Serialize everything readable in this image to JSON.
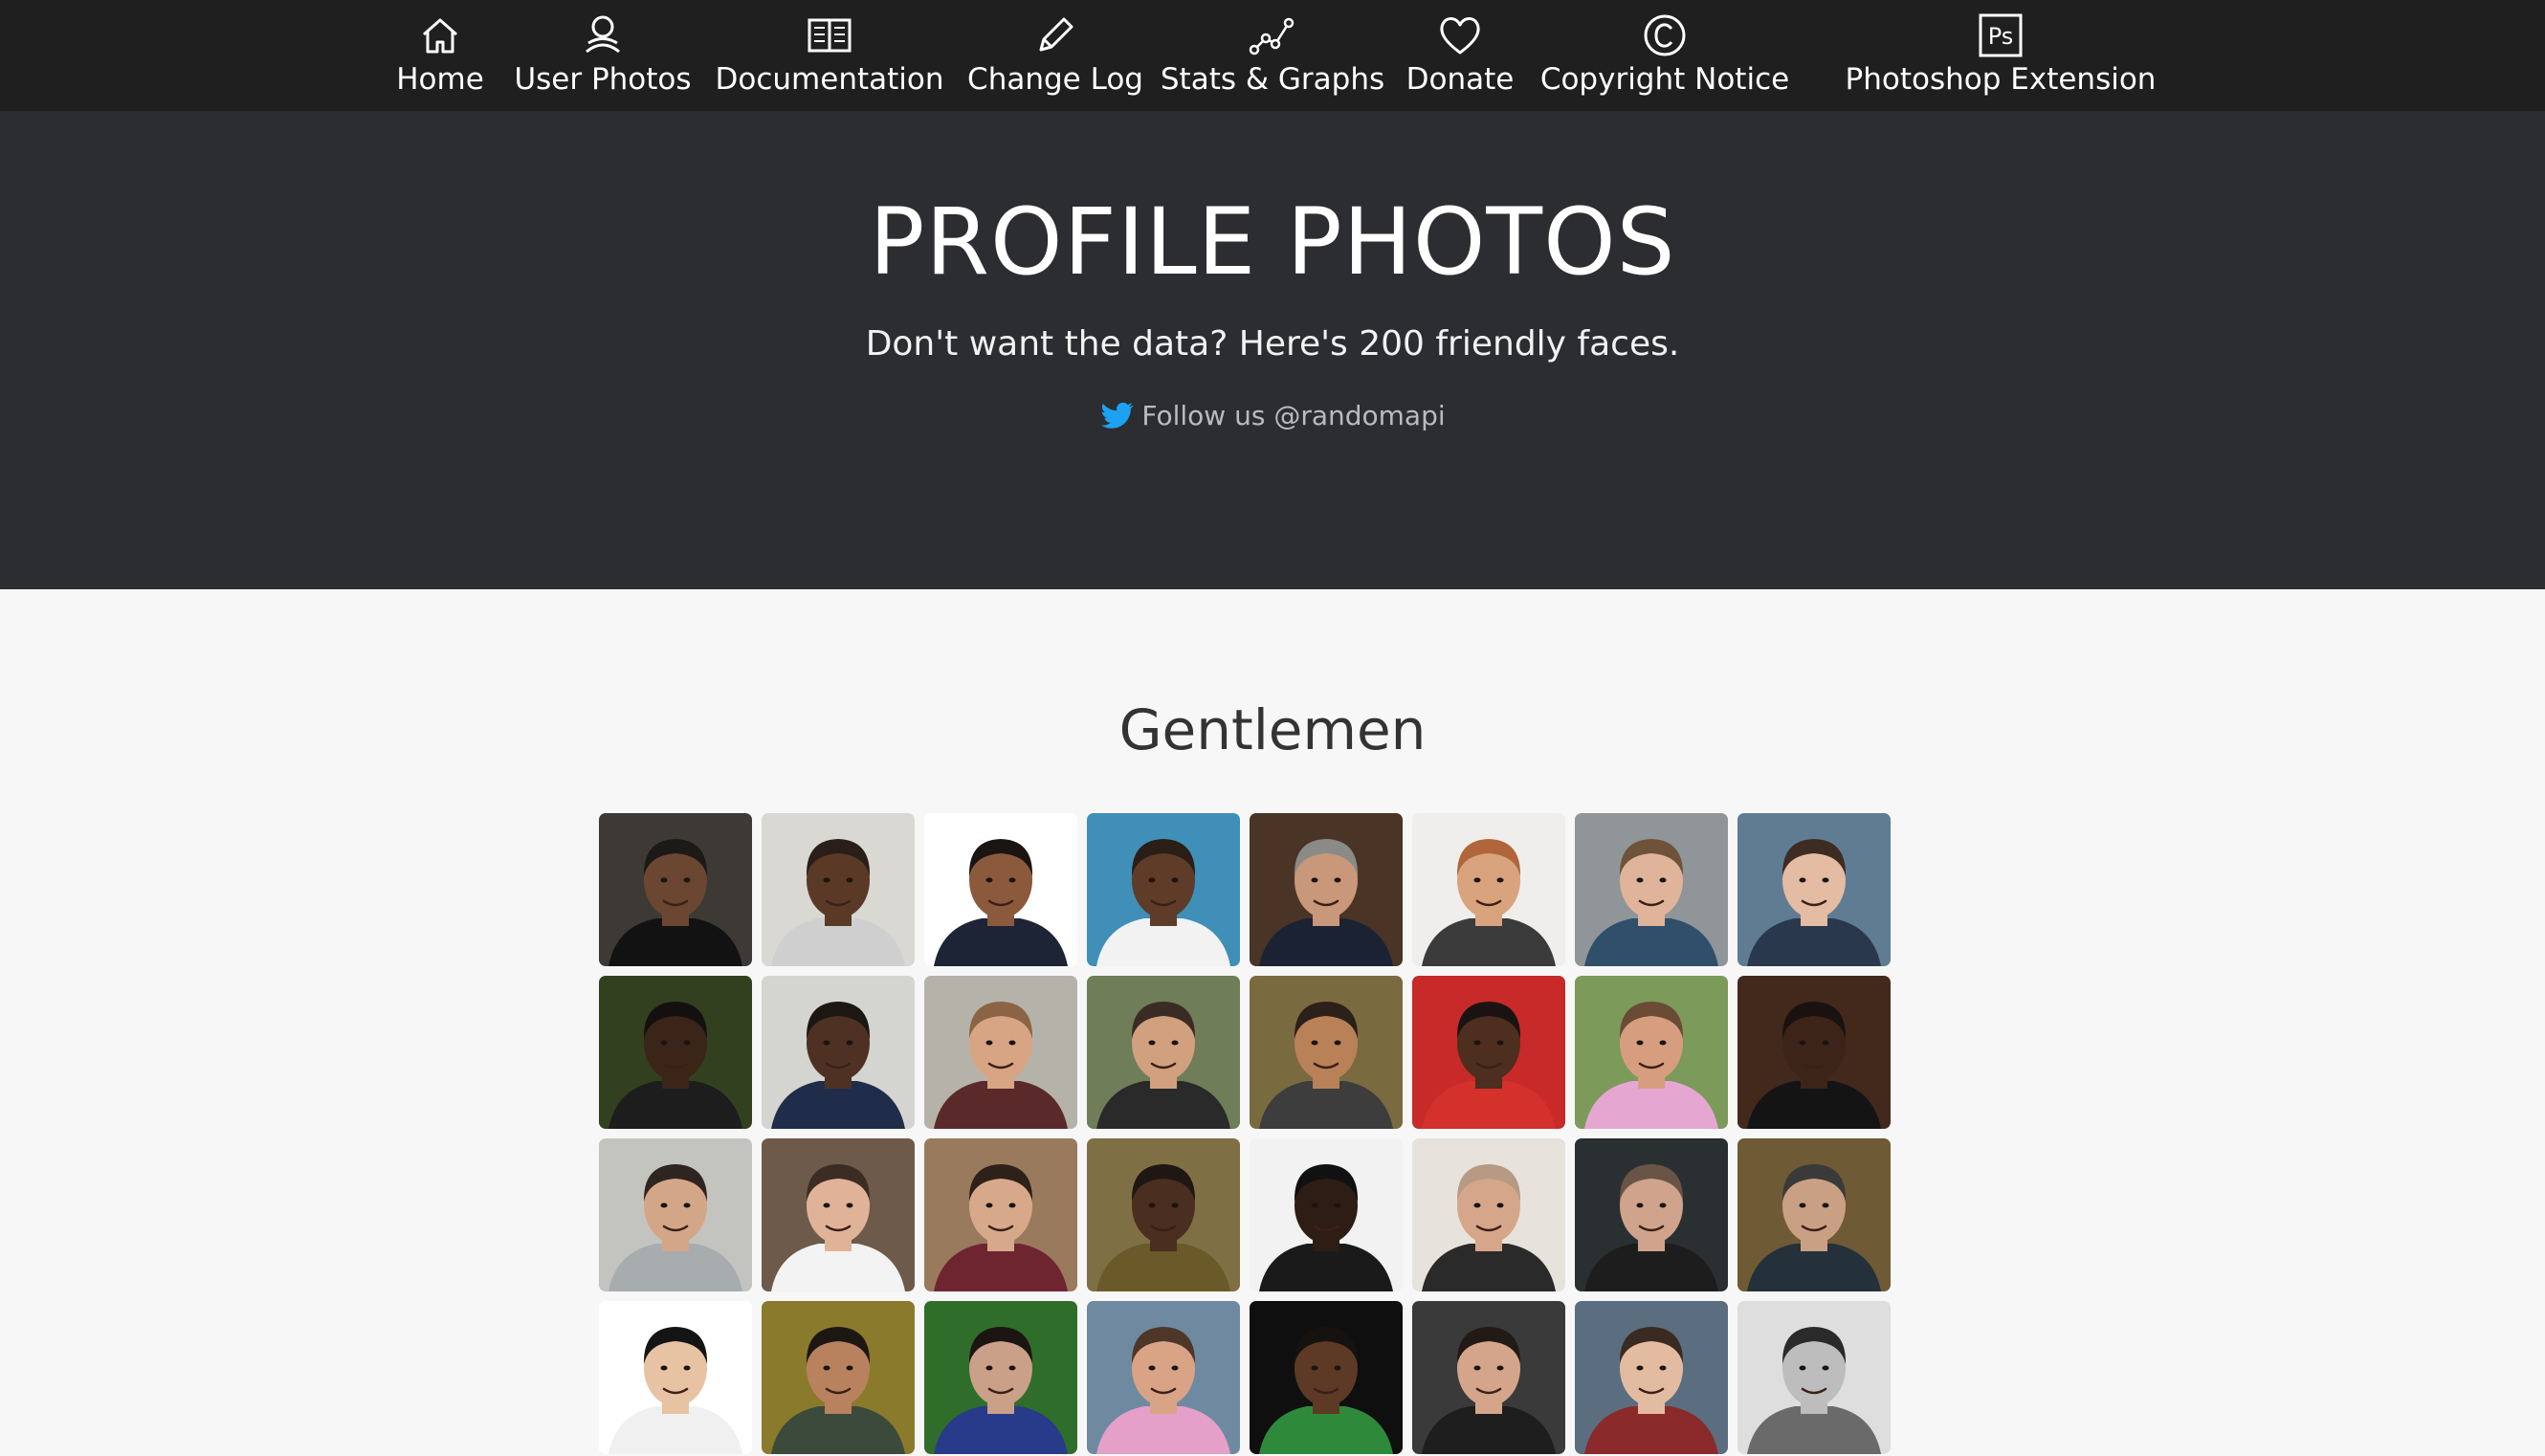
{
  "nav": {
    "items": [
      {
        "label": "Home",
        "icon": "home-icon"
      },
      {
        "label": "User Photos",
        "icon": "user-photos-icon"
      },
      {
        "label": "Documentation",
        "icon": "book-icon"
      },
      {
        "label": "Change Log",
        "icon": "pencil-icon"
      },
      {
        "label": "Stats & Graphs",
        "icon": "graph-icon"
      },
      {
        "label": "Donate",
        "icon": "heart-icon"
      },
      {
        "label": "Copyright Notice",
        "icon": "copyright-icon"
      },
      {
        "label": "Photoshop Extension",
        "icon": "photoshop-icon"
      }
    ]
  },
  "hero": {
    "title": "PROFILE PHOTOS",
    "subtitle": "Don't want the data? Here's 200 friendly faces.",
    "follow": "Follow us @randomapi",
    "follow_icon": "twitter-bird-icon",
    "twitter_color": "#1da1f2"
  },
  "section": {
    "title": "Gentlemen"
  },
  "photos": [
    {
      "bg": "#3d3a36",
      "skin": "#6b4630",
      "hair": "#1c1a18",
      "shirt": "#121212"
    },
    {
      "bg": "#d9d8d3",
      "skin": "#5a3a26",
      "hair": "#2a1f18",
      "shirt": "#cfcfcf"
    },
    {
      "bg": "#ffffff",
      "skin": "#8b5a3c",
      "hair": "#1a1512",
      "shirt": "#1c2436"
    },
    {
      "bg": "#3f8fb8",
      "skin": "#5e3c28",
      "hair": "#2a1e16",
      "shirt": "#f2f2f2"
    },
    {
      "bg": "#4a3426",
      "skin": "#c9977a",
      "hair": "#8a8a86",
      "shirt": "#1b2233"
    },
    {
      "bg": "#efeeec",
      "skin": "#d9a37e",
      "hair": "#b0663a",
      "shirt": "#3b3b3b"
    },
    {
      "bg": "#8f9599",
      "skin": "#e0b49a",
      "hair": "#6e5239",
      "shirt": "#2f4f6b"
    },
    {
      "bg": "#5f7c93",
      "skin": "#e4bba3",
      "hair": "#3d2c22",
      "shirt": "#29384d"
    },
    {
      "bg": "#33401f",
      "skin": "#3b2418",
      "hair": "#151010",
      "shirt": "#1d1d1d"
    },
    {
      "bg": "#d4d4d0",
      "skin": "#4e3122",
      "hair": "#1d1713",
      "shirt": "#1f2d4a"
    },
    {
      "bg": "#b5b2aa",
      "skin": "#d7a584",
      "hair": "#8a6444",
      "shirt": "#5a2a2a"
    },
    {
      "bg": "#6f7d58",
      "skin": "#d1a07e",
      "hair": "#3a2c24",
      "shirt": "#2a2a2a"
    },
    {
      "bg": "#7a6a40",
      "skin": "#b98158",
      "hair": "#2b201a",
      "shirt": "#3d3d3d"
    },
    {
      "bg": "#c72a28",
      "skin": "#4d2e1f",
      "hair": "#1a1311",
      "shirt": "#d4302c"
    },
    {
      "bg": "#7c9a5a",
      "skin": "#d69e7e",
      "hair": "#6a4b36",
      "shirt": "#e6a6d2"
    },
    {
      "bg": "#43281c",
      "skin": "#3d2418",
      "hair": "#1a1210",
      "shirt": "#141414"
    },
    {
      "bg": "#c3c3bf",
      "skin": "#d4a688",
      "hair": "#2f2520",
      "shirt": "#a7acae"
    },
    {
      "bg": "#6e5a4a",
      "skin": "#e0b398",
      "hair": "#3b2d24",
      "shirt": "#f3f3f3"
    },
    {
      "bg": "#9a7a5c",
      "skin": "#d7a98a",
      "hair": "#2d2119",
      "shirt": "#6e2530"
    },
    {
      "bg": "#7f6f44",
      "skin": "#4a2e1f",
      "hair": "#1f1713",
      "shirt": "#6a5a2a"
    },
    {
      "bg": "#f2f2f2",
      "skin": "#2e1d14",
      "hair": "#111111",
      "shirt": "#1a1a1a"
    },
    {
      "bg": "#e7e3dc",
      "skin": "#d6a68a",
      "hair": "#b69a84",
      "shirt": "#2a2a2a"
    },
    {
      "bg": "#2a3032",
      "skin": "#d0a48c",
      "hair": "#6a5446",
      "shirt": "#1d1d1d"
    },
    {
      "bg": "#6e5a34",
      "skin": "#caa084",
      "hair": "#3a3a3a",
      "shirt": "#24303a"
    },
    {
      "bg": "#ffffff",
      "skin": "#e7c3a3",
      "hair": "#141414",
      "shirt": "#f0f0f0"
    },
    {
      "bg": "#8a7a2c",
      "skin": "#b8825e",
      "hair": "#1d1714",
      "shirt": "#3b4a3b"
    },
    {
      "bg": "#2f6e2a",
      "skin": "#caa088",
      "hair": "#1c1613",
      "shirt": "#283a8a"
    },
    {
      "bg": "#6f8aa0",
      "skin": "#d9a386",
      "hair": "#4e3628",
      "shirt": "#e4a0c8"
    },
    {
      "bg": "#0f0f0f",
      "skin": "#5c3a26",
      "hair": "#161210",
      "shirt": "#2e8a3a"
    },
    {
      "bg": "#3a3a3a",
      "skin": "#d4a58a",
      "hair": "#221a16",
      "shirt": "#1e1e1e"
    },
    {
      "bg": "#5a6e80",
      "skin": "#e3bba0",
      "hair": "#3a2b22",
      "shirt": "#8a2a2a"
    },
    {
      "bg": "#dedede",
      "skin": "#bdbdbd",
      "hair": "#2a2a2a",
      "shirt": "#6a6a6a"
    }
  ]
}
